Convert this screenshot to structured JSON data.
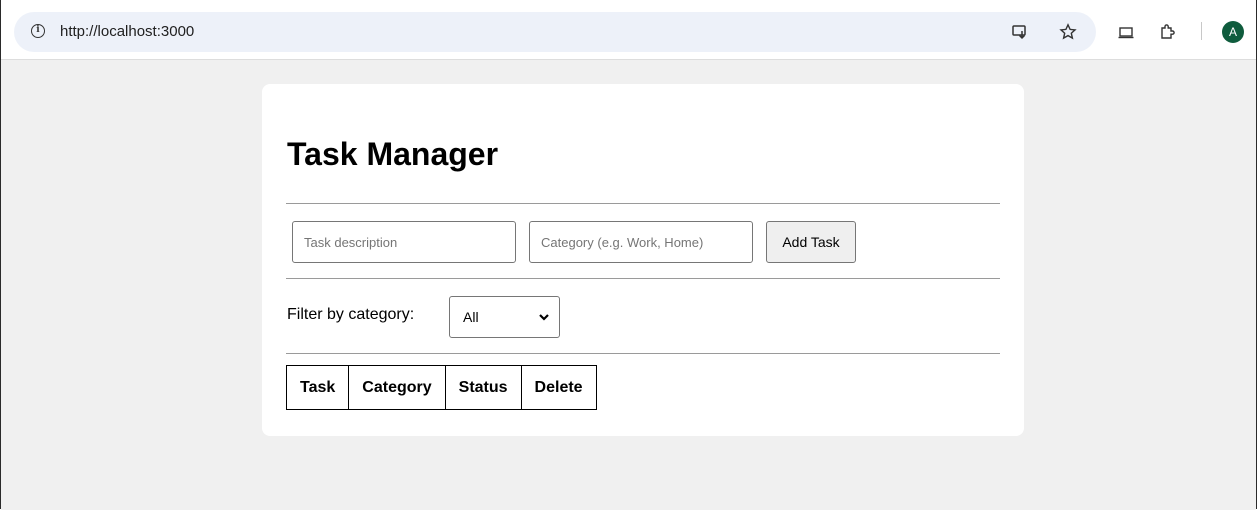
{
  "browser": {
    "url": "http://localhost:3000",
    "profile_initial": "A",
    "avatar_color": "#0f5c3d",
    "icons": [
      "info-icon",
      "install-app-icon",
      "bookmark-star-icon",
      "device-icon",
      "extensions-icon"
    ]
  },
  "app": {
    "title": "Task Manager",
    "background": "#f0f0f0",
    "form": {
      "task_placeholder": "Task description",
      "category_placeholder": "Category (e.g. Work, Home)",
      "task_value": "",
      "category_value": "",
      "add_button_label": "Add Task"
    },
    "filter": {
      "label": "Filter by category:",
      "selected": "All"
    },
    "table": {
      "headers": [
        "Task",
        "Category",
        "Status",
        "Delete"
      ],
      "rows": []
    }
  }
}
